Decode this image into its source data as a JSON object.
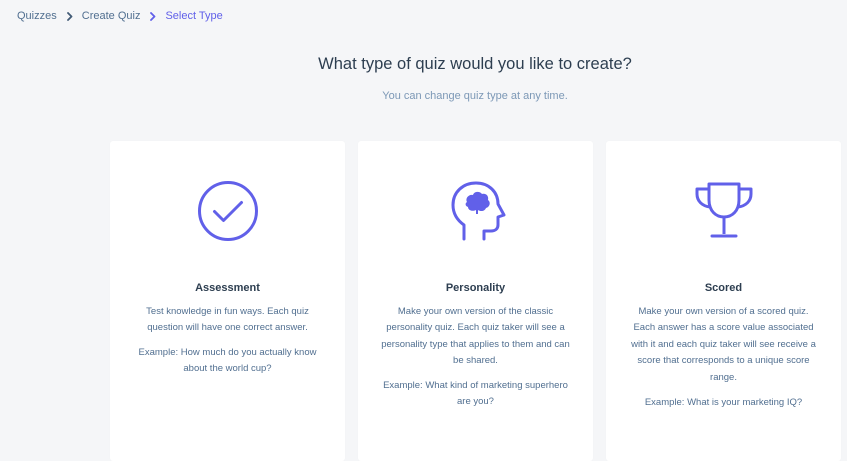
{
  "breadcrumb": {
    "items": [
      {
        "label": "Quizzes",
        "active": false
      },
      {
        "label": "Create Quiz",
        "active": false
      },
      {
        "label": "Select Type",
        "active": true
      }
    ]
  },
  "header": {
    "title": "What type of quiz would you like to create?",
    "subtitle": "You can change quiz type at any time."
  },
  "cards": [
    {
      "icon": "check-circle-icon",
      "title": "Assessment",
      "description": "Test knowledge in fun ways. Each quiz question will have one correct answer.",
      "example": "Example: How much do you actually know about the world cup?"
    },
    {
      "icon": "head-brain-icon",
      "title": "Personality",
      "description": "Make your own version of the classic personality quiz. Each quiz taker will see a personality type that applies to them and can be shared.",
      "example": "Example: What kind of marketing superhero are you?"
    },
    {
      "icon": "trophy-icon",
      "title": "Scored",
      "description": "Make your own version of a scored quiz. Each answer has a score value associated with it and each quiz taker will see receive a score that corresponds to a unique score range.",
      "example": "Example: What is your marketing IQ?"
    }
  ],
  "colors": {
    "accent": "#6160e9",
    "background": "#f5f6f8",
    "card": "#ffffff",
    "text": "#33475b",
    "muted": "#7c98b6"
  }
}
